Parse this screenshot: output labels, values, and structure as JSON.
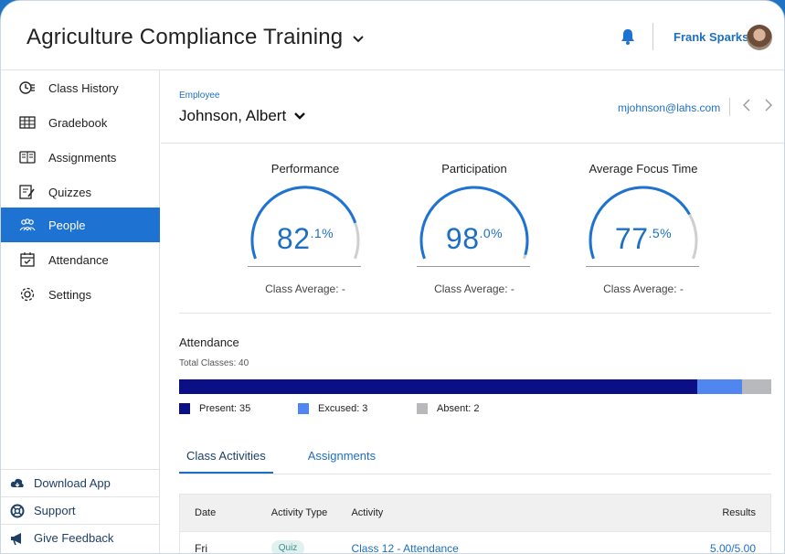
{
  "header": {
    "app_title": "Agriculture Compliance Training",
    "user_name": "Frank Sparks"
  },
  "sidebar": {
    "items": [
      {
        "label": "Class History",
        "icon": "clock-list-icon",
        "active": false
      },
      {
        "label": "Gradebook",
        "icon": "gradebook-icon",
        "active": false
      },
      {
        "label": "Assignments",
        "icon": "book-icon",
        "active": false
      },
      {
        "label": "Quizzes",
        "icon": "quiz-edit-icon",
        "active": false
      },
      {
        "label": "People",
        "icon": "people-icon",
        "active": true
      },
      {
        "label": "Attendance",
        "icon": "calendar-check-icon",
        "active": false
      },
      {
        "label": "Settings",
        "icon": "gear-icon",
        "active": false
      }
    ],
    "bottom": [
      {
        "label": "Download App",
        "icon": "cloud-download-icon"
      },
      {
        "label": "Support",
        "icon": "lifebuoy-icon"
      },
      {
        "label": "Give Feedback",
        "icon": "megaphone-icon"
      }
    ]
  },
  "employee": {
    "label": "Employee",
    "name": "Johnson, Albert",
    "email": "mjohnson@lahs.com"
  },
  "gauges": [
    {
      "title": "Performance",
      "value_main": "82",
      "value_sup": ".1%",
      "percent": 82.1,
      "avg": "Class Average: -"
    },
    {
      "title": "Participation",
      "value_main": "98",
      "value_sup": ".0%",
      "percent": 98.0,
      "avg": "Class Average: -"
    },
    {
      "title": "Average Focus Time",
      "value_main": "77",
      "value_sup": ".5%",
      "percent": 77.5,
      "avg": "Class Average: -"
    }
  ],
  "attendance": {
    "title": "Attendance",
    "total_label": "Total Classes: 40",
    "total": 40,
    "segments": [
      {
        "label": "Present: 35",
        "count": 35,
        "color": "#0a0f85"
      },
      {
        "label": "Excused: 3",
        "count": 3,
        "color": "#4f86f0"
      },
      {
        "label": "Absent: 2",
        "count": 2,
        "color": "#b7b9bd"
      }
    ]
  },
  "tabs": [
    {
      "label": "Class Activities",
      "active": true
    },
    {
      "label": "Assignments",
      "active": false
    }
  ],
  "table": {
    "headers": {
      "date": "Date",
      "type": "Activity Type",
      "activity": "Activity",
      "results": "Results"
    },
    "rows": [
      {
        "date": "Fri",
        "type": "Quiz",
        "activity": "Class 12 - Attendance",
        "results": "5.00/5.00"
      }
    ]
  },
  "colors": {
    "accent": "#1e73d2",
    "link": "#1e6fc1",
    "gauge_track": "#cfcfcf"
  }
}
